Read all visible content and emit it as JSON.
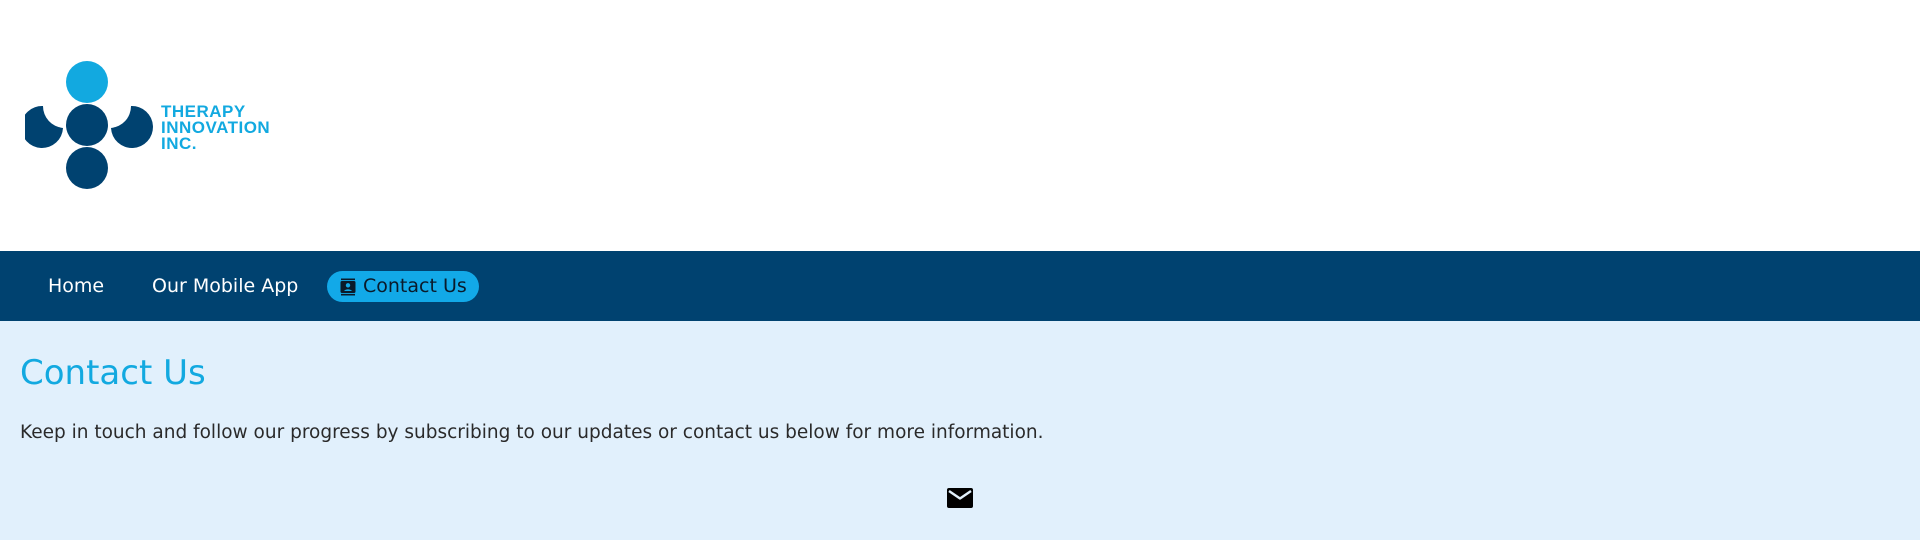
{
  "header": {
    "logo": {
      "name": "therapy-innovation-logo",
      "lines": [
        "THERAPY",
        "INNOVATION",
        "INC."
      ],
      "colors": {
        "light": "#12a9e0",
        "dark": "#004270"
      }
    }
  },
  "nav": {
    "items": [
      {
        "label": "Home"
      },
      {
        "label": "Our Mobile App"
      },
      {
        "label": "Contact Us",
        "icon": "contact-card-icon",
        "active": true
      }
    ],
    "background": "#004270",
    "active_color": "#12a9e8"
  },
  "main": {
    "title": "Contact Us",
    "intro": "Keep in touch and follow our progress by subscribing to our updates or contact us below for more information.",
    "email_icon": "envelope-icon",
    "background": "#e1f0fc"
  }
}
